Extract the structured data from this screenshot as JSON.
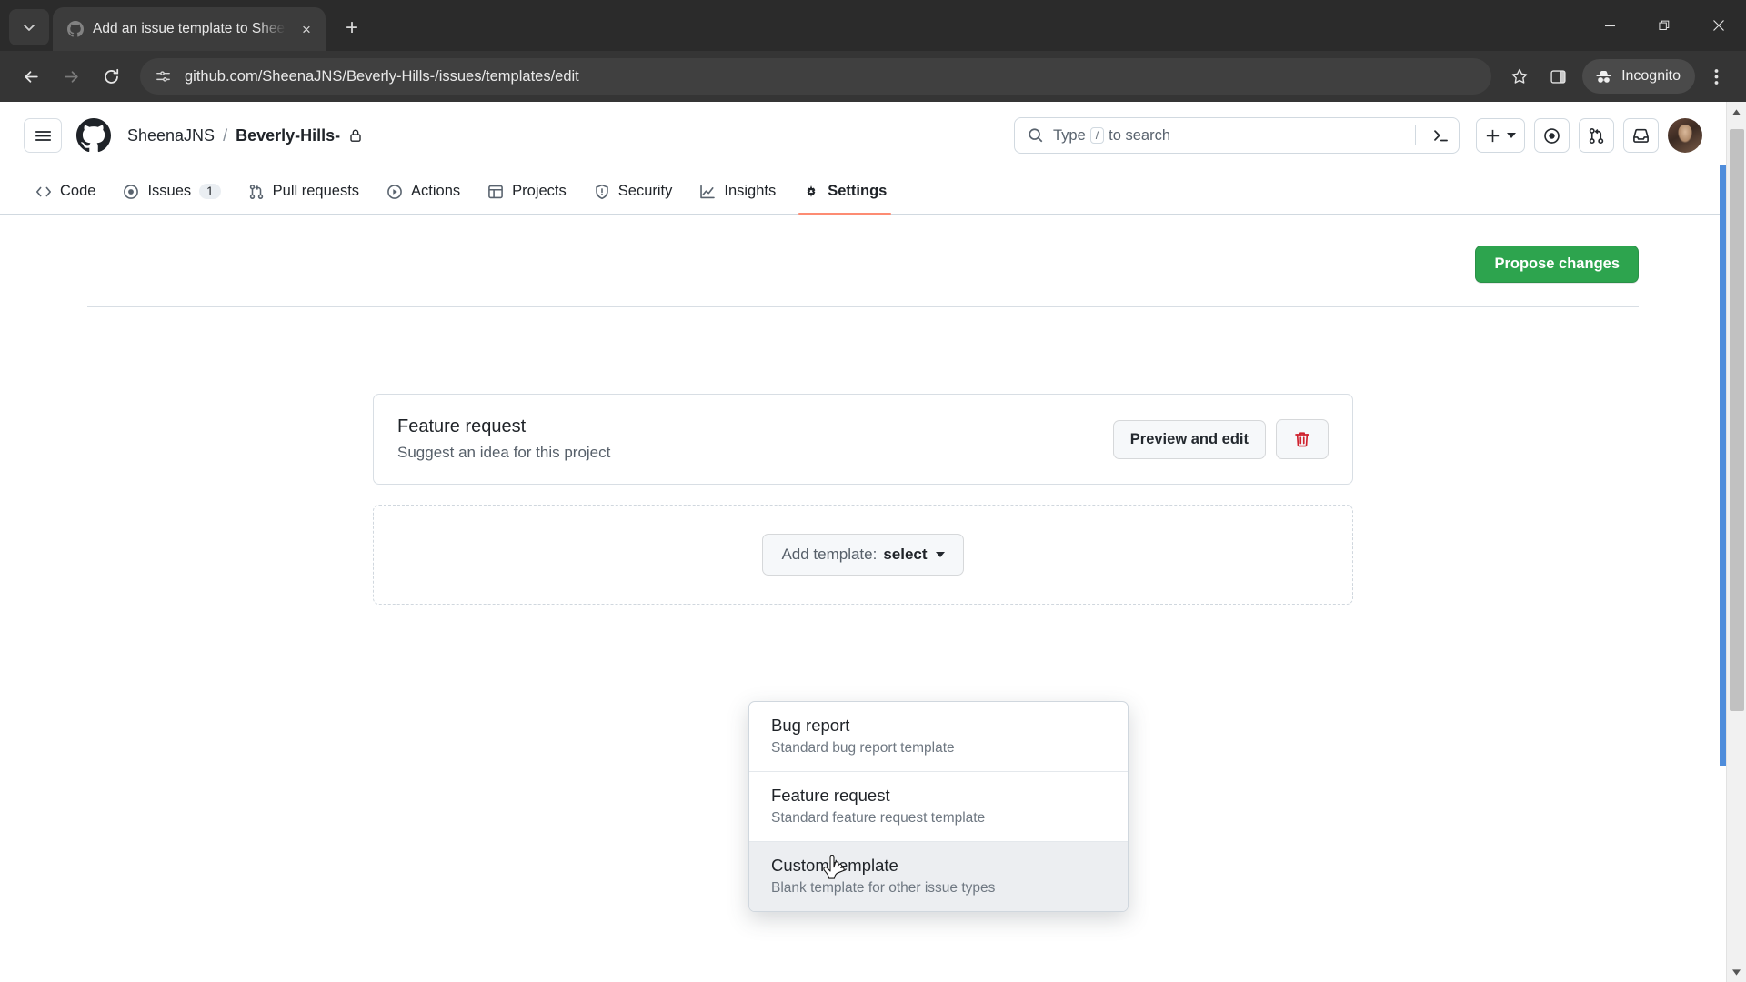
{
  "browser": {
    "tab": {
      "title": "Add an issue template to Sheen",
      "favicon_name": "github-favicon",
      "close_label": "×"
    },
    "new_tab_label": "+",
    "tab_search_name": "tab-search-chevron",
    "window_controls": {
      "minimize": "—",
      "maximize": "❐",
      "close": "✕"
    },
    "url": "github.com/SheenaJNS/Beverly-Hills-/issues/templates/edit",
    "site_info_icon": "site-settings-icon",
    "back_label": "←",
    "forward_label": "→",
    "reload_label": "↻",
    "bookmark_icon": "star-icon",
    "side_panel_icon": "side-panel-icon",
    "incognito_label": "Incognito",
    "menu_icon": "kebab-menu-icon"
  },
  "github": {
    "hamburger_name": "global-nav-menu",
    "logo_name": "github-logo",
    "breadcrumb": {
      "owner": "SheenaJNS",
      "separator": "/",
      "repo": "Beverly-Hills-",
      "visibility_icon": "lock-icon"
    },
    "search": {
      "placeholder_prefix": "Type",
      "placeholder_key": "/",
      "placeholder_suffix": "to search",
      "icon": "search-icon",
      "command_icon": "terminal-icon"
    },
    "header_actions": [
      {
        "name": "create-new-button",
        "icon": "plus-icon",
        "has_caret": true
      },
      {
        "name": "issues-button",
        "icon": "issue-opened-icon",
        "has_caret": false
      },
      {
        "name": "pull-requests-button",
        "icon": "git-pull-request-icon",
        "has_caret": false
      },
      {
        "name": "notifications-button",
        "icon": "inbox-icon",
        "has_caret": false
      }
    ],
    "avatar_name": "user-avatar",
    "nav_tabs": [
      {
        "label": "Code",
        "icon": "code-icon",
        "count": null,
        "active": false
      },
      {
        "label": "Issues",
        "icon": "issue-opened-icon",
        "count": "1",
        "active": false
      },
      {
        "label": "Pull requests",
        "icon": "git-pull-request-icon",
        "count": null,
        "active": false
      },
      {
        "label": "Actions",
        "icon": "play-icon",
        "count": null,
        "active": false
      },
      {
        "label": "Projects",
        "icon": "table-icon",
        "count": null,
        "active": false
      },
      {
        "label": "Security",
        "icon": "shield-icon",
        "count": null,
        "active": false
      },
      {
        "label": "Insights",
        "icon": "graph-icon",
        "count": null,
        "active": false
      },
      {
        "label": "Settings",
        "icon": "gear-icon",
        "count": null,
        "active": true
      }
    ]
  },
  "main": {
    "propose_changes_label": "Propose changes",
    "propose_changes_color": "#2da44e",
    "template_card": {
      "name": "Feature request",
      "description": "Suggest an idea for this project",
      "preview_edit_label": "Preview and edit",
      "delete_icon": "trash-icon",
      "delete_color": "#cf222e"
    },
    "add_template": {
      "label_muted": "Add template:",
      "label_strong": "select",
      "caret_icon": "chevron-down-icon"
    },
    "dropdown_options": [
      {
        "title": "Bug report",
        "subtitle": "Standard bug report template",
        "hovered": false
      },
      {
        "title": "Feature request",
        "subtitle": "Standard feature request template",
        "hovered": false
      },
      {
        "title": "Custom template",
        "subtitle": "Blank template for other issue types",
        "hovered": true
      }
    ]
  },
  "scrollbar": {
    "up_arrow": "▲",
    "down_arrow": "▼"
  }
}
